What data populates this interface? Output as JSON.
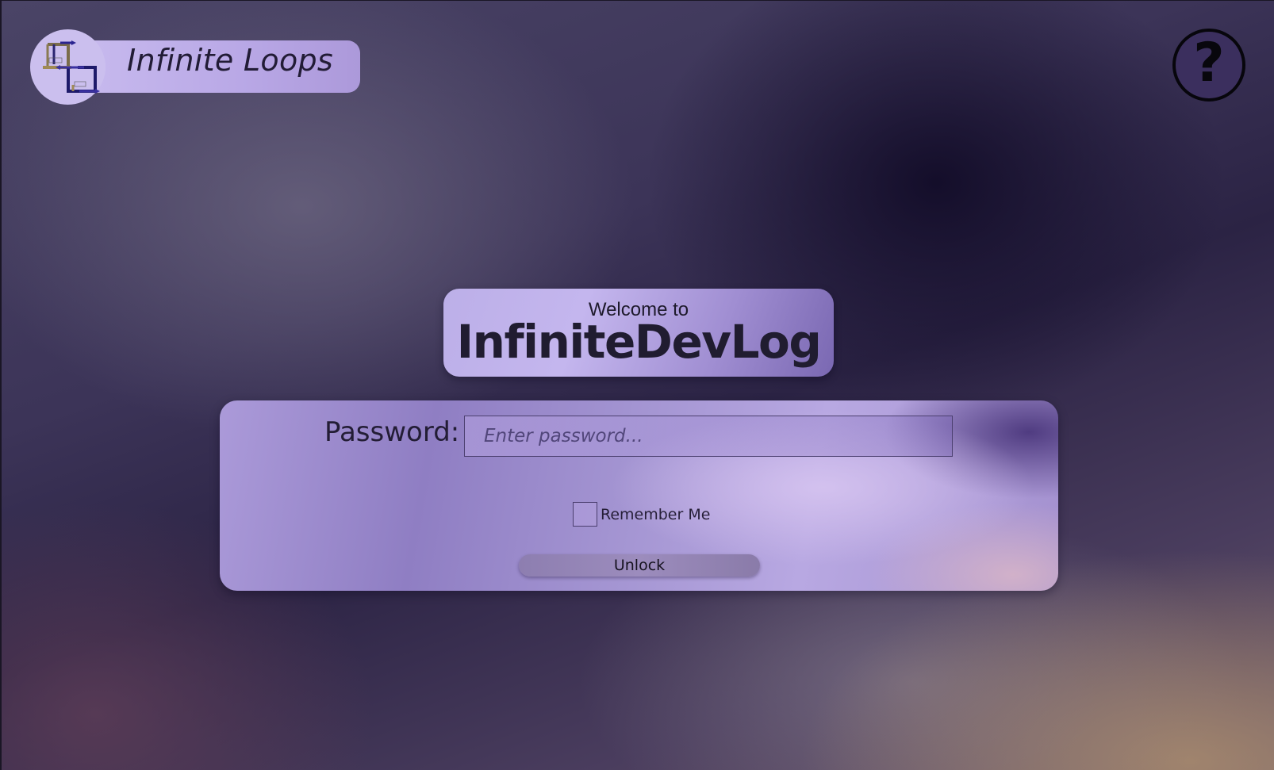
{
  "brand": {
    "name": "Infinite Loops",
    "logo_icon": "infinite-loops-logo-icon"
  },
  "help": {
    "label": "?"
  },
  "welcome": {
    "subtitle": "Welcome to",
    "title": "InfiniteDevLog"
  },
  "login": {
    "password_label": "Password:",
    "password_value": "",
    "password_placeholder": "Enter password...",
    "remember_label": "Remember Me",
    "remember_checked": false,
    "unlock_label": "Unlock"
  },
  "colors": {
    "card_accent": "#b9a8e6",
    "text_dark": "#221c36",
    "help_fill": "#3b2f5e"
  }
}
